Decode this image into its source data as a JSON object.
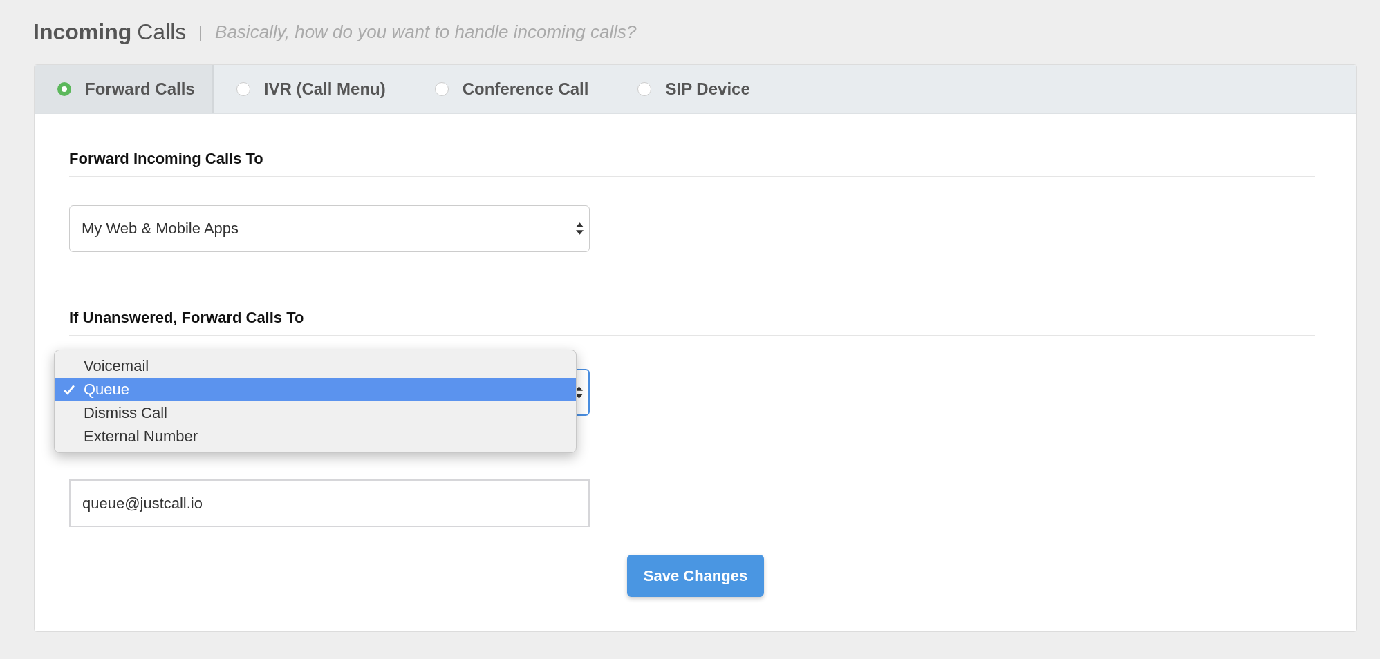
{
  "page_title": {
    "bold": "Incoming",
    "rest": "Calls",
    "separator": "|",
    "subtitle": "Basically, how do you want to handle incoming calls?"
  },
  "tabs": [
    {
      "label": "Forward Calls",
      "selected": true
    },
    {
      "label": "IVR (Call Menu)",
      "selected": false
    },
    {
      "label": "Conference Call",
      "selected": false
    },
    {
      "label": "SIP Device",
      "selected": false
    }
  ],
  "sections": [
    {
      "heading": "Forward Incoming Calls To",
      "kind": "select",
      "value": "My Web & Mobile Apps",
      "focused": false
    },
    {
      "heading": "If Unanswered, Forward Calls To",
      "kind": "select",
      "focused": true,
      "dropdown": [
        {
          "label": "Voicemail",
          "selected": false
        },
        {
          "label": "Queue",
          "selected": true
        },
        {
          "label": "Dismiss Call",
          "selected": false
        },
        {
          "label": "External Number",
          "selected": false
        }
      ]
    },
    {
      "kind": "text",
      "value": "queue@justcall.io"
    }
  ],
  "save_button": "Save Changes"
}
